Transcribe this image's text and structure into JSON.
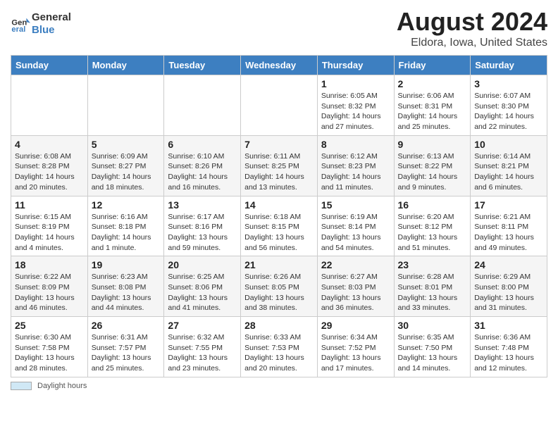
{
  "header": {
    "logo_line1": "General",
    "logo_line2": "Blue",
    "main_title": "August 2024",
    "subtitle": "Eldora, Iowa, United States"
  },
  "footer": {
    "daylight_label": "Daylight hours"
  },
  "calendar": {
    "weekdays": [
      "Sunday",
      "Monday",
      "Tuesday",
      "Wednesday",
      "Thursday",
      "Friday",
      "Saturday"
    ],
    "weeks": [
      [
        {
          "day": "",
          "info": ""
        },
        {
          "day": "",
          "info": ""
        },
        {
          "day": "",
          "info": ""
        },
        {
          "day": "",
          "info": ""
        },
        {
          "day": "1",
          "info": "Sunrise: 6:05 AM\nSunset: 8:32 PM\nDaylight: 14 hours and 27 minutes."
        },
        {
          "day": "2",
          "info": "Sunrise: 6:06 AM\nSunset: 8:31 PM\nDaylight: 14 hours and 25 minutes."
        },
        {
          "day": "3",
          "info": "Sunrise: 6:07 AM\nSunset: 8:30 PM\nDaylight: 14 hours and 22 minutes."
        }
      ],
      [
        {
          "day": "4",
          "info": "Sunrise: 6:08 AM\nSunset: 8:28 PM\nDaylight: 14 hours and 20 minutes."
        },
        {
          "day": "5",
          "info": "Sunrise: 6:09 AM\nSunset: 8:27 PM\nDaylight: 14 hours and 18 minutes."
        },
        {
          "day": "6",
          "info": "Sunrise: 6:10 AM\nSunset: 8:26 PM\nDaylight: 14 hours and 16 minutes."
        },
        {
          "day": "7",
          "info": "Sunrise: 6:11 AM\nSunset: 8:25 PM\nDaylight: 14 hours and 13 minutes."
        },
        {
          "day": "8",
          "info": "Sunrise: 6:12 AM\nSunset: 8:23 PM\nDaylight: 14 hours and 11 minutes."
        },
        {
          "day": "9",
          "info": "Sunrise: 6:13 AM\nSunset: 8:22 PM\nDaylight: 14 hours and 9 minutes."
        },
        {
          "day": "10",
          "info": "Sunrise: 6:14 AM\nSunset: 8:21 PM\nDaylight: 14 hours and 6 minutes."
        }
      ],
      [
        {
          "day": "11",
          "info": "Sunrise: 6:15 AM\nSunset: 8:19 PM\nDaylight: 14 hours and 4 minutes."
        },
        {
          "day": "12",
          "info": "Sunrise: 6:16 AM\nSunset: 8:18 PM\nDaylight: 14 hours and 1 minute."
        },
        {
          "day": "13",
          "info": "Sunrise: 6:17 AM\nSunset: 8:16 PM\nDaylight: 13 hours and 59 minutes."
        },
        {
          "day": "14",
          "info": "Sunrise: 6:18 AM\nSunset: 8:15 PM\nDaylight: 13 hours and 56 minutes."
        },
        {
          "day": "15",
          "info": "Sunrise: 6:19 AM\nSunset: 8:14 PM\nDaylight: 13 hours and 54 minutes."
        },
        {
          "day": "16",
          "info": "Sunrise: 6:20 AM\nSunset: 8:12 PM\nDaylight: 13 hours and 51 minutes."
        },
        {
          "day": "17",
          "info": "Sunrise: 6:21 AM\nSunset: 8:11 PM\nDaylight: 13 hours and 49 minutes."
        }
      ],
      [
        {
          "day": "18",
          "info": "Sunrise: 6:22 AM\nSunset: 8:09 PM\nDaylight: 13 hours and 46 minutes."
        },
        {
          "day": "19",
          "info": "Sunrise: 6:23 AM\nSunset: 8:08 PM\nDaylight: 13 hours and 44 minutes."
        },
        {
          "day": "20",
          "info": "Sunrise: 6:25 AM\nSunset: 8:06 PM\nDaylight: 13 hours and 41 minutes."
        },
        {
          "day": "21",
          "info": "Sunrise: 6:26 AM\nSunset: 8:05 PM\nDaylight: 13 hours and 38 minutes."
        },
        {
          "day": "22",
          "info": "Sunrise: 6:27 AM\nSunset: 8:03 PM\nDaylight: 13 hours and 36 minutes."
        },
        {
          "day": "23",
          "info": "Sunrise: 6:28 AM\nSunset: 8:01 PM\nDaylight: 13 hours and 33 minutes."
        },
        {
          "day": "24",
          "info": "Sunrise: 6:29 AM\nSunset: 8:00 PM\nDaylight: 13 hours and 31 minutes."
        }
      ],
      [
        {
          "day": "25",
          "info": "Sunrise: 6:30 AM\nSunset: 7:58 PM\nDaylight: 13 hours and 28 minutes."
        },
        {
          "day": "26",
          "info": "Sunrise: 6:31 AM\nSunset: 7:57 PM\nDaylight: 13 hours and 25 minutes."
        },
        {
          "day": "27",
          "info": "Sunrise: 6:32 AM\nSunset: 7:55 PM\nDaylight: 13 hours and 23 minutes."
        },
        {
          "day": "28",
          "info": "Sunrise: 6:33 AM\nSunset: 7:53 PM\nDaylight: 13 hours and 20 minutes."
        },
        {
          "day": "29",
          "info": "Sunrise: 6:34 AM\nSunset: 7:52 PM\nDaylight: 13 hours and 17 minutes."
        },
        {
          "day": "30",
          "info": "Sunrise: 6:35 AM\nSunset: 7:50 PM\nDaylight: 13 hours and 14 minutes."
        },
        {
          "day": "31",
          "info": "Sunrise: 6:36 AM\nSunset: 7:48 PM\nDaylight: 13 hours and 12 minutes."
        }
      ]
    ]
  }
}
